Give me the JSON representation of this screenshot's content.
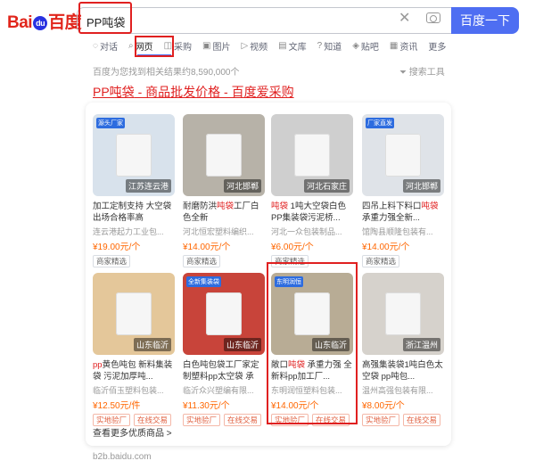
{
  "logo": {
    "bai": "Bai",
    "du": "du",
    "cn": "百度",
    "paw": "🐾"
  },
  "search": {
    "value": "PP吨袋",
    "button": "百度一下"
  },
  "tabs": [
    {
      "label": "对话",
      "icon": "chat-icon"
    },
    {
      "label": "网页",
      "icon": "web-icon"
    },
    {
      "label": "采购",
      "icon": "shopping-icon"
    },
    {
      "label": "图片",
      "icon": "image-icon"
    },
    {
      "label": "视频",
      "icon": "video-icon"
    },
    {
      "label": "文库",
      "icon": "document-icon"
    },
    {
      "label": "知道",
      "icon": "question-icon"
    },
    {
      "label": "贴吧",
      "icon": "forum-icon"
    },
    {
      "label": "资讯",
      "icon": "news-icon"
    },
    {
      "label": "更多",
      "icon": ""
    }
  ],
  "result_count": "百度为您找到相关结果约8,590,000个",
  "search_tools": "搜索工具",
  "result_title": {
    "highlight": "PP吨袋",
    "rest": " - 商品批发价格 - 百度爱采购"
  },
  "products": [
    {
      "tag": "江苏连云港",
      "corner": "源头厂家",
      "title_a": "加工定制支持 大空袋出场合格率高 ",
      "title_r": "",
      "title_b": "",
      "seller": "连云港起力工业包...",
      "price": "¥19.00元/个",
      "badges": [
        "商家精选"
      ],
      "img": "#d8e2ec"
    },
    {
      "tag": "河北邯郸",
      "corner": "",
      "title_a": "耐磨防洪",
      "title_r": "吨袋",
      "title_b": "工厂白色全新",
      "seller": "河北恒宏塑料编织...",
      "price": "¥14.00元/个",
      "badges": [
        "商家精选"
      ],
      "img": "#b7b2a8"
    },
    {
      "tag": "河北石家庄",
      "corner": "",
      "title_a": "",
      "title_r": "吨袋",
      "title_b": " 1吨大空袋白色PP集装袋污泥桥...",
      "seller": "河北一众包装制品...",
      "price": "¥6.00元/个",
      "badges": [
        "商家精选"
      ],
      "img": "#cfcfcf"
    },
    {
      "tag": "河北邯郸",
      "corner": "厂家直发",
      "title_a": "四吊上料下料口",
      "title_r": "吨袋",
      "title_b": " 承重力强全新...",
      "seller": "馆陶县顺隆包装有...",
      "price": "¥14.00元/个",
      "badges": [
        "商家精选"
      ],
      "img": "#dfe3e8"
    },
    {
      "tag": "山东临沂",
      "corner": "",
      "title_a": "",
      "title_r": "pp",
      "title_b": "黄色吨包 新料集装袋 污泥加厚吨...",
      "seller": "临沂佰玉塑料包装...",
      "price": "¥12.50元/件",
      "badges": [
        "实地验厂",
        "在线交易"
      ],
      "img": "#e4c79a"
    },
    {
      "tag": "山东临沂",
      "corner": "全新集装袋",
      "title_a": "白色吨包袋",
      "title_r": "",
      "title_b": "工厂家定制塑料pp太空袋 承重...",
      "seller": "临沂众兴塑编有限...",
      "price": "¥11.30元/个",
      "badges": [
        "实地验厂",
        "在线交易"
      ],
      "img": "#c8443a"
    },
    {
      "tag": "山东临沂",
      "corner": "东明润恒",
      "title_a": "敞口",
      "title_r": "吨袋",
      "title_b": " 承重力强 全新料pp加工厂...",
      "seller": "东明润恒塑料包装...",
      "price": "¥14.00元/个",
      "badges": [
        "实地验厂",
        "在线交易"
      ],
      "img": "#b8ac95"
    },
    {
      "tag": "浙江温州",
      "corner": "",
      "title_a": "高强集装袋",
      "title_r": "",
      "title_b": "1吨白色太空袋 pp吨包...",
      "seller": "温州高强包装有限...",
      "price": "¥8.00元/个",
      "badges": [
        "实地验厂",
        "在线交易"
      ],
      "img": "#d6d2cc"
    }
  ],
  "more_link": "查看更多优质商品 >",
  "footer_url": "b2b.baidu.com"
}
